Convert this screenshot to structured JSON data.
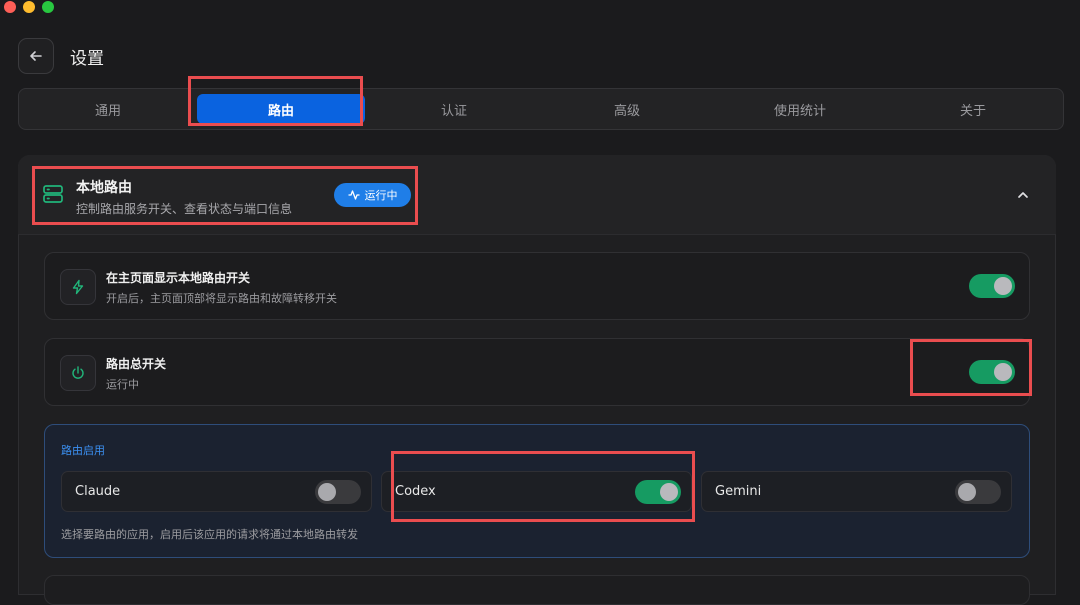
{
  "header": {
    "title": "设置"
  },
  "tabs": [
    {
      "label": "通用",
      "active": false
    },
    {
      "label": "路由",
      "active": true
    },
    {
      "label": "认证",
      "active": false
    },
    {
      "label": "高级",
      "active": false
    },
    {
      "label": "使用统计",
      "active": false
    },
    {
      "label": "关于",
      "active": false
    }
  ],
  "section": {
    "title": "本地路由",
    "subtitle": "控制路由服务开关、查看状态与端口信息",
    "status_badge": "运行中"
  },
  "rows": [
    {
      "title": "在主页面显示本地路由开关",
      "subtitle": "开启后，主页面顶部将显示路由和故障转移开关",
      "enabled": true,
      "icon": "lightning-icon"
    },
    {
      "title": "路由总开关",
      "subtitle": "运行中",
      "enabled": true,
      "icon": "power-icon"
    }
  ],
  "routing_enable": {
    "label": "路由启用",
    "apps": [
      {
        "name": "Claude",
        "enabled": false
      },
      {
        "name": "Codex",
        "enabled": true
      },
      {
        "name": "Gemini",
        "enabled": false
      }
    ],
    "hint": "选择要路由的应用，启用后该应用的请求将通过本地路由转发"
  },
  "colors": {
    "accent": "#0a63e0",
    "toggle_on": "#169b62",
    "highlight": "#ea4d4f",
    "badge": "#1f7ee8"
  }
}
